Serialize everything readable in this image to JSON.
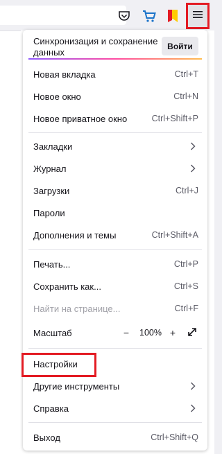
{
  "toolbar": {
    "icons": [
      "pocket-icon",
      "cart-icon",
      "bookmark-ribbon-icon",
      "hamburger-menu-icon"
    ],
    "accent_color": "#e31b23"
  },
  "panel": {
    "sync_text": "Синхронизация и сохранение данных",
    "login_label": "Войти",
    "items": [
      {
        "label": "Новая вкладка",
        "shortcut": "Ctrl+T"
      },
      {
        "label": "Новое окно",
        "shortcut": "Ctrl+N"
      },
      {
        "label": "Новое приватное окно",
        "shortcut": "Ctrl+Shift+P"
      },
      {
        "label": "Закладки",
        "shortcut": ""
      },
      {
        "label": "Журнал",
        "shortcut": ""
      },
      {
        "label": "Загрузки",
        "shortcut": "Ctrl+J"
      },
      {
        "label": "Пароли",
        "shortcut": ""
      },
      {
        "label": "Дополнения и темы",
        "shortcut": "Ctrl+Shift+A"
      },
      {
        "label": "Печать...",
        "shortcut": "Ctrl+P"
      },
      {
        "label": "Сохранить как...",
        "shortcut": "Ctrl+S"
      },
      {
        "label": "Найти на странице...",
        "shortcut": "Ctrl+F"
      },
      {
        "label": "Масштаб",
        "shortcut": ""
      },
      {
        "label": "Настройки",
        "shortcut": ""
      },
      {
        "label": "Другие инструменты",
        "shortcut": ""
      },
      {
        "label": "Справка",
        "shortcut": ""
      },
      {
        "label": "Выход",
        "shortcut": "Ctrl+Shift+Q"
      }
    ],
    "zoom": {
      "minus": "−",
      "value": "100%",
      "plus": "+"
    }
  }
}
